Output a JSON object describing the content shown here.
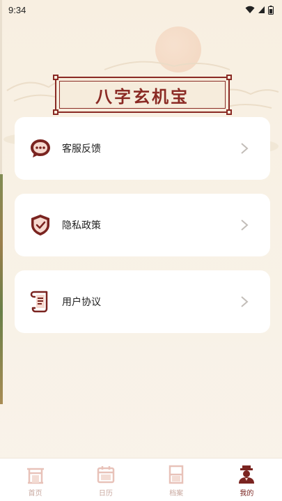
{
  "status_bar": {
    "time": "9:34"
  },
  "banner": {
    "title": "八字玄机宝"
  },
  "menu": [
    {
      "label": "客服反馈",
      "icon": "chat-bubble-icon"
    },
    {
      "label": "隐私政策",
      "icon": "shield-check-icon"
    },
    {
      "label": "用户协议",
      "icon": "scroll-document-icon"
    }
  ],
  "tabbar": {
    "tabs": [
      {
        "label": "首页",
        "icon": "home-gate-icon",
        "active": false
      },
      {
        "label": "日历",
        "icon": "calendar-icon",
        "active": false
      },
      {
        "label": "档案",
        "icon": "archive-icon",
        "active": false
      },
      {
        "label": "我的",
        "icon": "profile-icon",
        "active": true
      }
    ]
  },
  "colors": {
    "accent": "#8a2a24",
    "background": "#f8efe1",
    "inactive_tab": "#c9a9a0"
  }
}
